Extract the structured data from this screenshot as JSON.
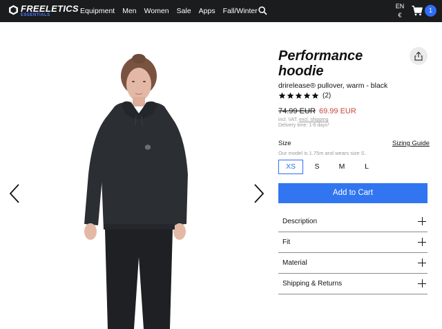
{
  "header": {
    "brand": "FREELETICS",
    "brand_sub": "ESSENTIALS",
    "nav": [
      "Equipment",
      "Men",
      "Women",
      "Sale",
      "Apps",
      "Fall/Winter"
    ],
    "lang": "EN",
    "currency": "€",
    "cart_count": "1"
  },
  "product": {
    "title": "Performance hoodie",
    "subtitle": "drirelease® pullover, warm - black",
    "rating_stars": 5,
    "review_count": "(2)",
    "price_old": "74.99 EUR",
    "price_new": "69.99 EUR",
    "vat_prefix": "incl. VAT,",
    "vat_link": "excl. shipping",
    "delivery": "Delivery time: 1-6 days*",
    "size_label": "Size",
    "size_guide": "Sizing Guide",
    "model_note": "Our model is 1.75m and wears size S.",
    "sizes": [
      "XS",
      "S",
      "M",
      "L"
    ],
    "selected_size": "XS",
    "add_to_cart": "Add to Cart",
    "accordion": [
      "Description",
      "Fit",
      "Material",
      "Shipping & Returns"
    ]
  },
  "colors": {
    "header_bg": "#1b1c1e",
    "accent": "#3176f0",
    "sale_price": "#c9453c"
  },
  "icons": [
    "logo-icon",
    "search-icon",
    "cart-icon",
    "share-icon",
    "star-icon",
    "chevron-left-icon",
    "chevron-right-icon",
    "plus-icon"
  ]
}
